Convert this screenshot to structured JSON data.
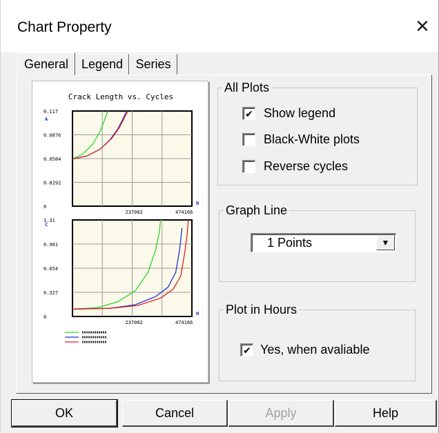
{
  "window": {
    "title": "Chart Property",
    "close_glyph": "✕"
  },
  "tabs": [
    {
      "label": "General",
      "active": true
    },
    {
      "label": "Legend",
      "active": false
    },
    {
      "label": "Series",
      "active": false
    }
  ],
  "all_plots": {
    "title": "All Plots",
    "options": [
      {
        "label": "Show legend",
        "checked": true
      },
      {
        "label": "Black-White plots",
        "checked": false
      },
      {
        "label": "Reverse cycles",
        "checked": false
      }
    ]
  },
  "graph_line": {
    "title": "Graph Line",
    "selected": "1  Points"
  },
  "plot_in_hours": {
    "title": "Plot in Hours",
    "option": {
      "label": "Yes, when avaliable",
      "checked": true
    }
  },
  "buttons": {
    "ok": "OK",
    "cancel": "Cancel",
    "apply": "Apply",
    "help": "Help"
  },
  "colors": {
    "series_blue": "#1f2fd6",
    "series_green": "#2bd42b",
    "series_red": "#e02020"
  },
  "chart_data": [
    {
      "type": "line",
      "title": "Crack Length vs. Cycles",
      "ylabel": "A",
      "xlabel": "N",
      "y_ticks": [
        "0.117",
        "0.0876",
        "0.0584",
        "0.0292",
        "0"
      ],
      "x_ticks": [
        "237082",
        "474166"
      ],
      "ylim": [
        0,
        0.117
      ],
      "xlim": [
        0,
        474166
      ],
      "grid": true,
      "series": [
        {
          "color": "#2bd42b",
          "x": [
            0,
            40000,
            80000,
            110000,
            125000,
            140000
          ],
          "y": [
            0.058,
            0.064,
            0.076,
            0.092,
            0.104,
            0.117
          ]
        },
        {
          "color": "#1f2fd6",
          "x": [
            0,
            60000,
            110000,
            150000,
            180000,
            200000,
            215000
          ],
          "y": [
            0.058,
            0.062,
            0.07,
            0.082,
            0.095,
            0.107,
            0.117
          ]
        },
        {
          "color": "#e02020",
          "x": [
            0,
            60000,
            110000,
            155000,
            185000,
            205000,
            220000
          ],
          "y": [
            0.058,
            0.062,
            0.07,
            0.083,
            0.096,
            0.108,
            0.117
          ]
        }
      ]
    },
    {
      "type": "line",
      "ylabel": "C",
      "xlabel": "N",
      "y_ticks": [
        "1.31",
        "0.981",
        "0.654",
        "0.327",
        "0"
      ],
      "x_ticks": [
        "237082",
        "474166"
      ],
      "ylim": [
        0,
        1.31
      ],
      "xlim": [
        0,
        474166
      ],
      "grid": true,
      "series": [
        {
          "color": "#2bd42b",
          "x": [
            0,
            100000,
            180000,
            250000,
            300000,
            330000,
            345000,
            350000
          ],
          "y": [
            0.1,
            0.12,
            0.2,
            0.35,
            0.6,
            0.9,
            1.15,
            1.31
          ]
        },
        {
          "color": "#1f2fd6",
          "x": [
            0,
            150000,
            250000,
            330000,
            380000,
            410000,
            425000,
            435000
          ],
          "y": [
            0.1,
            0.11,
            0.16,
            0.27,
            0.4,
            0.6,
            0.9,
            1.2
          ]
        },
        {
          "color": "#e02020",
          "x": [
            0,
            150000,
            260000,
            350000,
            400000,
            430000,
            445000,
            455000,
            460000
          ],
          "y": [
            0.1,
            0.11,
            0.15,
            0.25,
            0.37,
            0.55,
            0.85,
            1.1,
            1.31
          ]
        }
      ],
      "legend": {
        "position": "bottom-left"
      }
    }
  ]
}
